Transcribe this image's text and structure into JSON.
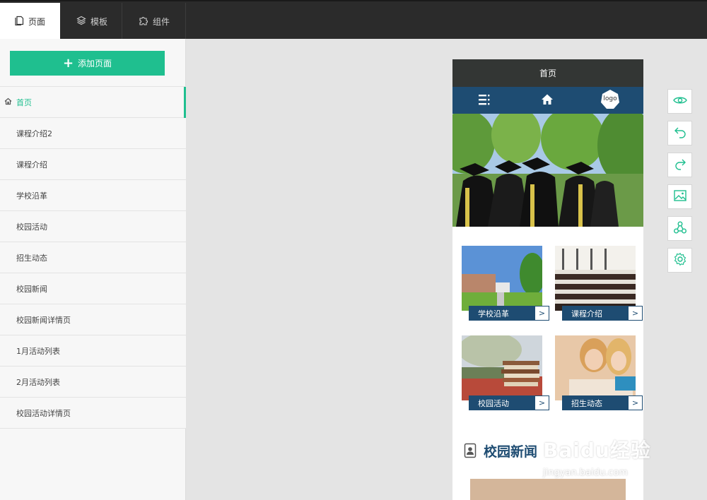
{
  "top_tabs": [
    {
      "label": "页面",
      "icon": "page-icon"
    },
    {
      "label": "模板",
      "icon": "layers-icon"
    },
    {
      "label": "组件",
      "icon": "puzzle-icon"
    }
  ],
  "sidebar": {
    "add_page_label": "添加页面",
    "pages": [
      {
        "label": "首页",
        "icon": "home-icon",
        "active": true
      },
      {
        "label": "课程介绍2"
      },
      {
        "label": "课程介绍"
      },
      {
        "label": "学校沿革"
      },
      {
        "label": "校园活动"
      },
      {
        "label": "招生动态"
      },
      {
        "label": "校园新闻"
      },
      {
        "label": "校园新闻详情页"
      },
      {
        "label": "1月活动列表"
      },
      {
        "label": "2月活动列表"
      },
      {
        "label": "校园活动详情页"
      }
    ]
  },
  "phone": {
    "title": "首页",
    "nav": {
      "menu_icon": "menu-icon",
      "home_icon": "home-icon",
      "logo_text": "logo"
    },
    "cards": [
      {
        "label": "学校沿革",
        "arrow": ">",
        "image": "campus-buildings-photo"
      },
      {
        "label": "课程介绍",
        "arrow": ">",
        "image": "lecture-hall-photo"
      },
      {
        "label": "校园活动",
        "arrow": ">",
        "image": "book-stack-photo"
      },
      {
        "label": "招生动态",
        "arrow": ">",
        "image": "students-reading-photo"
      }
    ],
    "news_title": "校园新闻"
  },
  "tools": [
    {
      "icon": "eye-icon"
    },
    {
      "icon": "undo-icon"
    },
    {
      "icon": "redo-icon"
    },
    {
      "icon": "image-icon"
    },
    {
      "icon": "share-icon"
    },
    {
      "icon": "settings-icon"
    }
  ],
  "watermark": {
    "brand": "Baidu经验",
    "url": "jingyan.baidu.com"
  },
  "colors": {
    "accent": "#1fbf8f",
    "nav_blue": "#1e4c72",
    "topbar": "#2b2b2b"
  }
}
